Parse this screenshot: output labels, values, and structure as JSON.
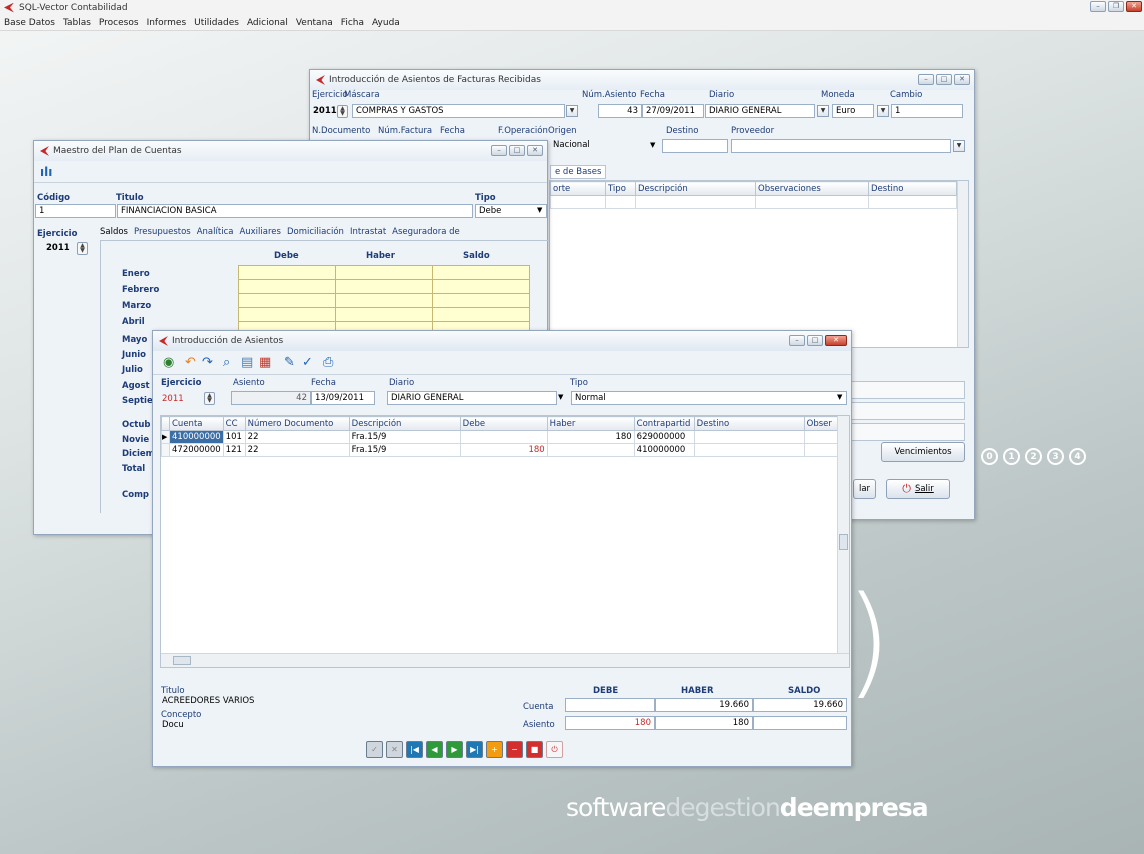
{
  "app": {
    "title": "SQL-Vector Contabilidad",
    "menu": [
      "Base Datos",
      "Tablas",
      "Procesos",
      "Informes",
      "Utilidades",
      "Adicional",
      "Ventana",
      "Ficha",
      "Ayuda"
    ]
  },
  "background": {
    "brand_light": "software",
    "brand_mid": "degestion",
    "brand_bold": "deempresa",
    "paren": ")",
    "steps": [
      "⓪",
      "①",
      "②",
      "③",
      "④"
    ]
  },
  "facturas": {
    "title": "Introducción de Asientos de Facturas Recibidas",
    "labels": {
      "ejercicio": "Ejercicio",
      "mascara": "Máscara",
      "num_asiento": "Núm.Asiento",
      "fecha": "Fecha",
      "diario": "Diario",
      "moneda": "Moneda",
      "cambio": "Cambio",
      "n_documento": "N.Documento",
      "num_factura": "Núm.Factura",
      "fecha2": "Fecha",
      "f_operacion": "F.Operación",
      "origen": "Origen",
      "destino": "Destino",
      "proveedor": "Proveedor"
    },
    "values": {
      "ejercicio": "2011",
      "mascara": "COMPRAS Y GASTOS",
      "num_asiento": "43",
      "fecha": "27/09/2011",
      "diario": "DIARIO GENERAL",
      "moneda": "Euro",
      "cambio": "1",
      "origen": "Nacional"
    },
    "tab_bases": "e de Bases",
    "grid_headers": [
      "orte",
      "Tipo",
      "Descripción",
      "Observaciones",
      "Destino"
    ],
    "btn_vencimientos": "Vencimientos",
    "btn_cancelar": "lar",
    "btn_salir": "Salir"
  },
  "plan": {
    "title": "Maestro del Plan de Cuentas",
    "labels": {
      "codigo": "Código",
      "titulo": "Titulo",
      "tipo": "Tipo",
      "ejercicio": "Ejercicio"
    },
    "values": {
      "codigo": "1",
      "titulo": "FINANCIACION BASICA",
      "tipo": "Debe",
      "ejercicio": "2011"
    },
    "tabs": [
      "Saldos",
      "Presupuestos",
      "Analítica",
      "Auxiliares",
      "Domiciliación",
      "Intrastat",
      "Aseguradora de"
    ],
    "cols": [
      "Debe",
      "Haber",
      "Saldo"
    ],
    "months": [
      "Enero",
      "Febrero",
      "Marzo",
      "Abril",
      "Mayo",
      "Junio",
      "Julio",
      "Agost",
      "Septie",
      "Octub",
      "Novie",
      "Diciem",
      "Total"
    ],
    "comp": "Comp"
  },
  "asientos": {
    "title": "Introducción de Asientos",
    "labels": {
      "ejercicio": "Ejercicio",
      "asiento": "Asiento",
      "fecha": "Fecha",
      "diario": "Diario",
      "tipo": "Tipo"
    },
    "values": {
      "ejercicio": "2011",
      "asiento": "42",
      "fecha": "13/09/2011",
      "diario": "DIARIO GENERAL",
      "tipo": "Normal"
    },
    "headers": [
      "Cuenta",
      "CC",
      "Número Documento",
      "Descripción",
      "Debe",
      "Haber",
      "Contrapartid",
      "Destino",
      "Obser"
    ],
    "rows": [
      {
        "cuenta": "410000000",
        "cc": "101",
        "doc": "22",
        "desc": "Fra.15/9",
        "debe": "",
        "haber": "180",
        "contra": "629000000",
        "destino": "",
        "obs": ""
      },
      {
        "cuenta": "472000000",
        "cc": "121",
        "doc": "22",
        "desc": "Fra.15/9",
        "debe": "180",
        "haber": "",
        "contra": "410000000",
        "destino": "",
        "obs": ""
      }
    ],
    "footer": {
      "titulo_lbl": "Titulo",
      "titulo_val": "ACREEDORES VARIOS",
      "concepto_lbl": "Concepto",
      "concepto_val": "Docu",
      "cols": [
        "DEBE",
        "HABER",
        "SALDO"
      ],
      "cuenta_lbl": "Cuenta",
      "cuenta_debe": "",
      "cuenta_haber": "19.660",
      "cuenta_saldo": "19.660",
      "asiento_lbl": "Asiento",
      "asiento_debe": "180",
      "asiento_haber": "180",
      "asiento_saldo": ""
    }
  }
}
